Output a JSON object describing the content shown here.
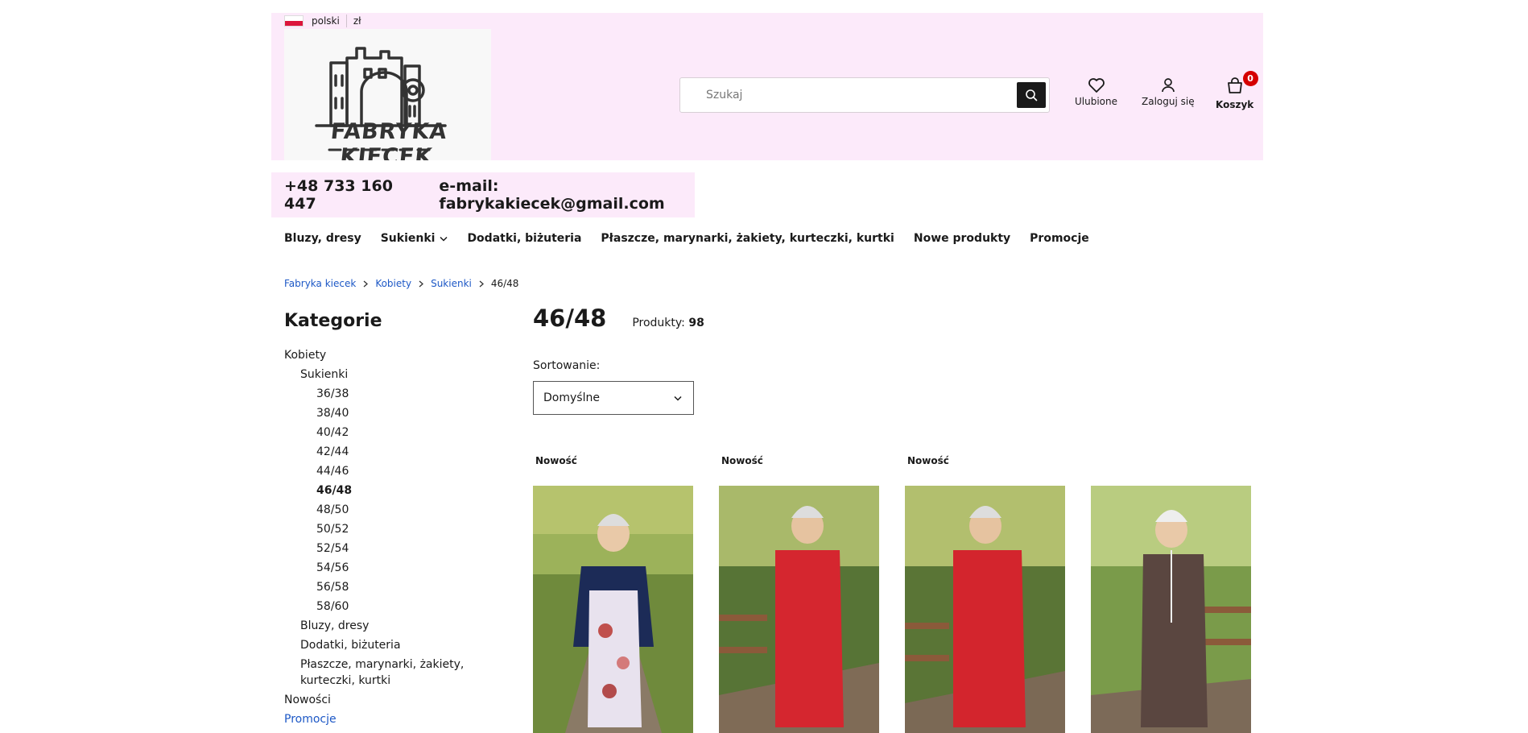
{
  "header": {
    "language": "polski",
    "currency": "zł",
    "logo_text": "FABRYKA KIECEK",
    "search_placeholder": "Szukaj",
    "favorites_label": "Ulubione",
    "login_label": "Zaloguj się",
    "cart_label": "Koszyk",
    "cart_count": "0"
  },
  "contact": {
    "phone": "+48 733 160 447",
    "email": "e-mail: fabrykakiecek@gmail.com"
  },
  "nav": {
    "items": [
      "Bluzy, dresy",
      "Sukienki",
      "Dodatki, biżuteria",
      "Płaszcze, marynarki, żakiety, kurteczki, kurtki",
      "Nowe produkty",
      "Promocje"
    ]
  },
  "breadcrumb": [
    "Fabryka kiecek",
    "Kobiety",
    "Sukienki",
    "46/48"
  ],
  "sidebar": {
    "title": "Kategorie",
    "items": [
      "Kobiety",
      "Sukienki",
      "36/38",
      "38/40",
      "40/42",
      "42/44",
      "44/46",
      "46/48",
      "48/50",
      "50/52",
      "52/54",
      "54/56",
      "56/58",
      "58/60",
      "Bluzy, dresy",
      "Dodatki, biżuteria",
      "Płaszcze, marynarki, żakiety, kurteczki, kurtki",
      "Nowości",
      "Promocje"
    ]
  },
  "listing": {
    "title": "46/48",
    "products_label": "Produkty:",
    "products_count": "98",
    "sort_label": "Sortowanie:",
    "sort_value": "Domyślne",
    "new_badge": "Nowość"
  },
  "colors": {
    "header_bg": "#fceafa",
    "link": "#1d58c6",
    "cart_badge": "#d50000"
  },
  "icons": [
    "search-icon",
    "heart-icon",
    "user-icon",
    "bag-icon",
    "chevron-down-icon",
    "chevron-right-icon"
  ]
}
